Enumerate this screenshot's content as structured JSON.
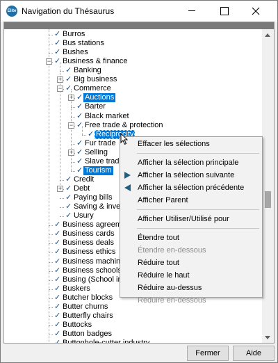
{
  "window": {
    "title": "Navigation du Thésaurus",
    "icon_label": "Elite"
  },
  "tree": {
    "nodes": [
      {
        "label": "Burros",
        "depth": 0,
        "selected": false
      },
      {
        "label": "Bus stations",
        "depth": 0,
        "selected": false
      },
      {
        "label": "Bushes",
        "depth": 0,
        "selected": false
      },
      {
        "label": "Business & finance",
        "depth": 0,
        "selected": false,
        "expander": "−"
      },
      {
        "label": "Banking",
        "depth": 1,
        "selected": false
      },
      {
        "label": "Big business",
        "depth": 1,
        "selected": false,
        "expander": "+"
      },
      {
        "label": "Commerce",
        "depth": 1,
        "selected": false,
        "expander": "−"
      },
      {
        "label": "Auctions",
        "depth": 2,
        "selected": true,
        "expander": "+"
      },
      {
        "label": "Barter",
        "depth": 2,
        "selected": false
      },
      {
        "label": "Black market",
        "depth": 2,
        "selected": false
      },
      {
        "label": "Free trade & protection",
        "depth": 2,
        "selected": false,
        "expander": "−"
      },
      {
        "label": "Reciprocity",
        "depth": 3,
        "selected": true,
        "focus": true
      },
      {
        "label": "Fur trade",
        "depth": 2,
        "selected": false
      },
      {
        "label": "Selling",
        "depth": 2,
        "selected": false,
        "expander": "+"
      },
      {
        "label": "Slave trade",
        "depth": 2,
        "selected": false
      },
      {
        "label": "Tourism",
        "depth": 2,
        "selected": true
      },
      {
        "label": "Credit",
        "depth": 1,
        "selected": false
      },
      {
        "label": "Debt",
        "depth": 1,
        "selected": false,
        "expander": "+"
      },
      {
        "label": "Paying bills",
        "depth": 1,
        "selected": false
      },
      {
        "label": "Saving & investm",
        "depth": 1,
        "selected": false
      },
      {
        "label": "Usury",
        "depth": 1,
        "selected": false
      },
      {
        "label": "Business agreements",
        "depth": 0,
        "selected": false
      },
      {
        "label": "Business cards",
        "depth": 0,
        "selected": false
      },
      {
        "label": "Business deals",
        "depth": 0,
        "selected": false
      },
      {
        "label": "Business ethics",
        "depth": 0,
        "selected": false
      },
      {
        "label": "Business machines",
        "depth": 0,
        "selected": false
      },
      {
        "label": "Business schools",
        "depth": 0,
        "selected": false
      },
      {
        "label": "Busing (School integr",
        "depth": 0,
        "selected": false
      },
      {
        "label": "Buskers",
        "depth": 0,
        "selected": false
      },
      {
        "label": "Butcher blocks",
        "depth": 0,
        "selected": false
      },
      {
        "label": "Butter churns",
        "depth": 0,
        "selected": false
      },
      {
        "label": "Butterfly chairs",
        "depth": 0,
        "selected": false
      },
      {
        "label": "Buttocks",
        "depth": 0,
        "selected": false
      },
      {
        "label": "Button badges",
        "depth": 0,
        "selected": false
      },
      {
        "label": "Buttonhole-cutter industry",
        "depth": 0,
        "selected": false
      }
    ]
  },
  "context_menu": {
    "items": [
      {
        "type": "item",
        "label": "Effacer les sélections",
        "name": "menu-clear-selections",
        "enabled": true
      },
      {
        "type": "sep"
      },
      {
        "type": "item",
        "label": "Afficher la sélection principale",
        "name": "menu-show-main-selection",
        "enabled": true
      },
      {
        "type": "item",
        "label": "Afficher la sélection suivante",
        "name": "menu-show-next-selection",
        "enabled": true,
        "icon": "arrow-right-icon"
      },
      {
        "type": "item",
        "label": "Afficher la sélection précédente",
        "name": "menu-show-previous-selection",
        "enabled": true,
        "icon": "arrow-left-icon"
      },
      {
        "type": "item",
        "label": "Afficher Parent",
        "name": "menu-show-parent",
        "enabled": true
      },
      {
        "type": "sep"
      },
      {
        "type": "item",
        "label": "Afficher Utiliser/Utilisé pour",
        "name": "menu-show-use-used-for",
        "enabled": true
      },
      {
        "type": "sep"
      },
      {
        "type": "item",
        "label": "Étendre tout",
        "name": "menu-expand-all",
        "enabled": true
      },
      {
        "type": "item",
        "label": "Étendre en-dessous",
        "name": "menu-expand-below",
        "enabled": false
      },
      {
        "type": "item",
        "label": "Réduire tout",
        "name": "menu-collapse-all",
        "enabled": true
      },
      {
        "type": "item",
        "label": "Réduire le haut",
        "name": "menu-collapse-top",
        "enabled": true
      },
      {
        "type": "item",
        "label": "Réduire au-dessus",
        "name": "menu-collapse-above",
        "enabled": true
      },
      {
        "type": "item",
        "label": "Réduire en-dessous",
        "name": "menu-collapse-below",
        "enabled": false
      }
    ]
  },
  "buttons": {
    "close_label": "Fermer",
    "help_label": "Aide"
  },
  "colors": {
    "selection": "#0078d7",
    "check": "#1a4a7a",
    "menu_arrow": "#1e5f82"
  },
  "icons": {
    "check": "checkmark-icon",
    "expand": "plus-box-icon",
    "collapse": "minus-box-icon"
  }
}
